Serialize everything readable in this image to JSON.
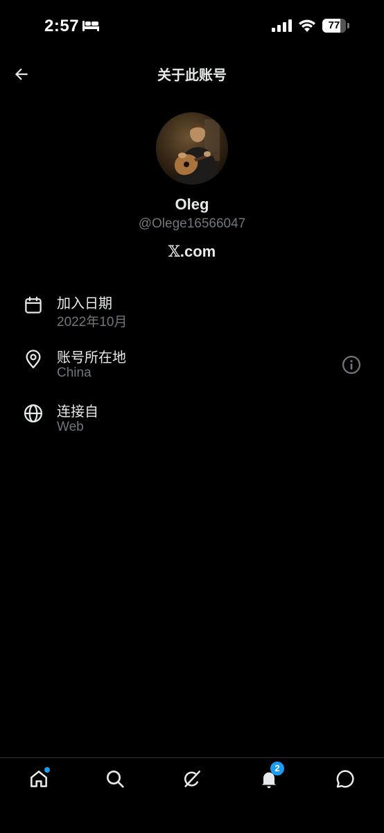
{
  "status_bar": {
    "time": "2:57",
    "battery_level": "77",
    "battery_fraction": 0.77,
    "icons": [
      "bed-icon",
      "cellular-signal-icon",
      "wifi-icon",
      "battery-icon"
    ]
  },
  "header": {
    "title": "关于此账号",
    "back_icon": "arrow-left-icon"
  },
  "profile": {
    "display_name": "Oleg",
    "handle": "@Olege16566047",
    "site_glyph": "𝕏",
    "site_suffix": ".com"
  },
  "info_rows": [
    {
      "icon": "calendar-icon",
      "label": "加入日期",
      "value": "2022年10月"
    },
    {
      "icon": "location-pin-icon",
      "label": "账号所在地",
      "value": "China",
      "action_icon": "info-circle-icon"
    },
    {
      "icon": "globe-icon",
      "label": "连接自",
      "value": "Web"
    }
  ],
  "tab_bar": {
    "tabs": [
      "home-icon",
      "search-icon",
      "grok-icon",
      "notifications-bell-icon",
      "messages-icon"
    ],
    "notification_count": "2"
  },
  "colors": {
    "background": "#000000",
    "primary_text": "#e7e9ea",
    "secondary_text": "#71767b",
    "accent": "#1d9bf0"
  }
}
